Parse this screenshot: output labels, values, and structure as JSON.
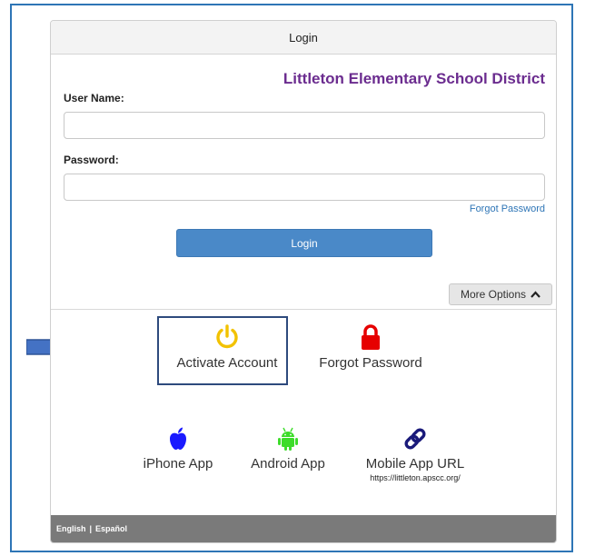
{
  "panel": {
    "header_title": "Login"
  },
  "district_name": "Littleton Elementary School District",
  "form": {
    "username_label": "User Name:",
    "username_value": "",
    "password_label": "Password:",
    "password_value": "",
    "forgot_password_link": "Forgot Password",
    "login_button": "Login",
    "more_options": "More Options"
  },
  "options": {
    "activate": "Activate Account",
    "forgot": "Forgot Password",
    "iphone": "iPhone App",
    "android": "Android App",
    "mobile_url": "Mobile App URL",
    "mobile_url_sub": "https://littleton.apscc.org/"
  },
  "footer": {
    "english": "English",
    "separator": "|",
    "espanol": "Español"
  },
  "colors": {
    "district": "#6b2c8f",
    "login_button": "#4a89c8",
    "activate_icon": "#f2c200",
    "lock_icon": "#e60000",
    "apple_icon": "#1a1aff",
    "android_icon": "#3ddc2a",
    "link_icon": "#1a1a7a",
    "arrow": "#4472c4"
  },
  "icons": {
    "activate": "power-icon",
    "forgot": "lock-icon",
    "iphone": "apple-icon",
    "android": "android-icon",
    "mobile_url": "link-icon"
  }
}
